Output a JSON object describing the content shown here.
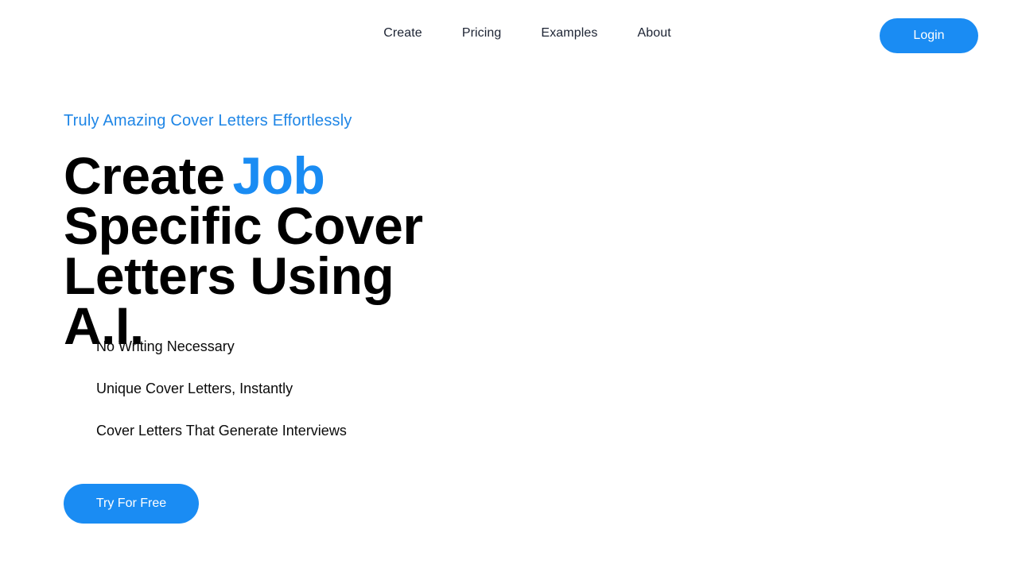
{
  "nav": {
    "links": [
      "Create",
      "Pricing",
      "Examples",
      "About"
    ],
    "login_label": "Login"
  },
  "hero": {
    "tagline": "Truly Amazing Cover Letters Effortlessly",
    "headline_start": "Create",
    "headline_accent": "Job",
    "headline_line2": "Specific Cover",
    "headline_line3": "Letters Using A.I.",
    "features": [
      "No Writing Necessary",
      "Unique Cover Letters, Instantly",
      "Cover Letters That Generate Interviews"
    ],
    "cta_label": "Try For Free"
  },
  "colors": {
    "accent": "#1a8cf3",
    "tagline": "#1f86e6",
    "text": "#000000"
  }
}
